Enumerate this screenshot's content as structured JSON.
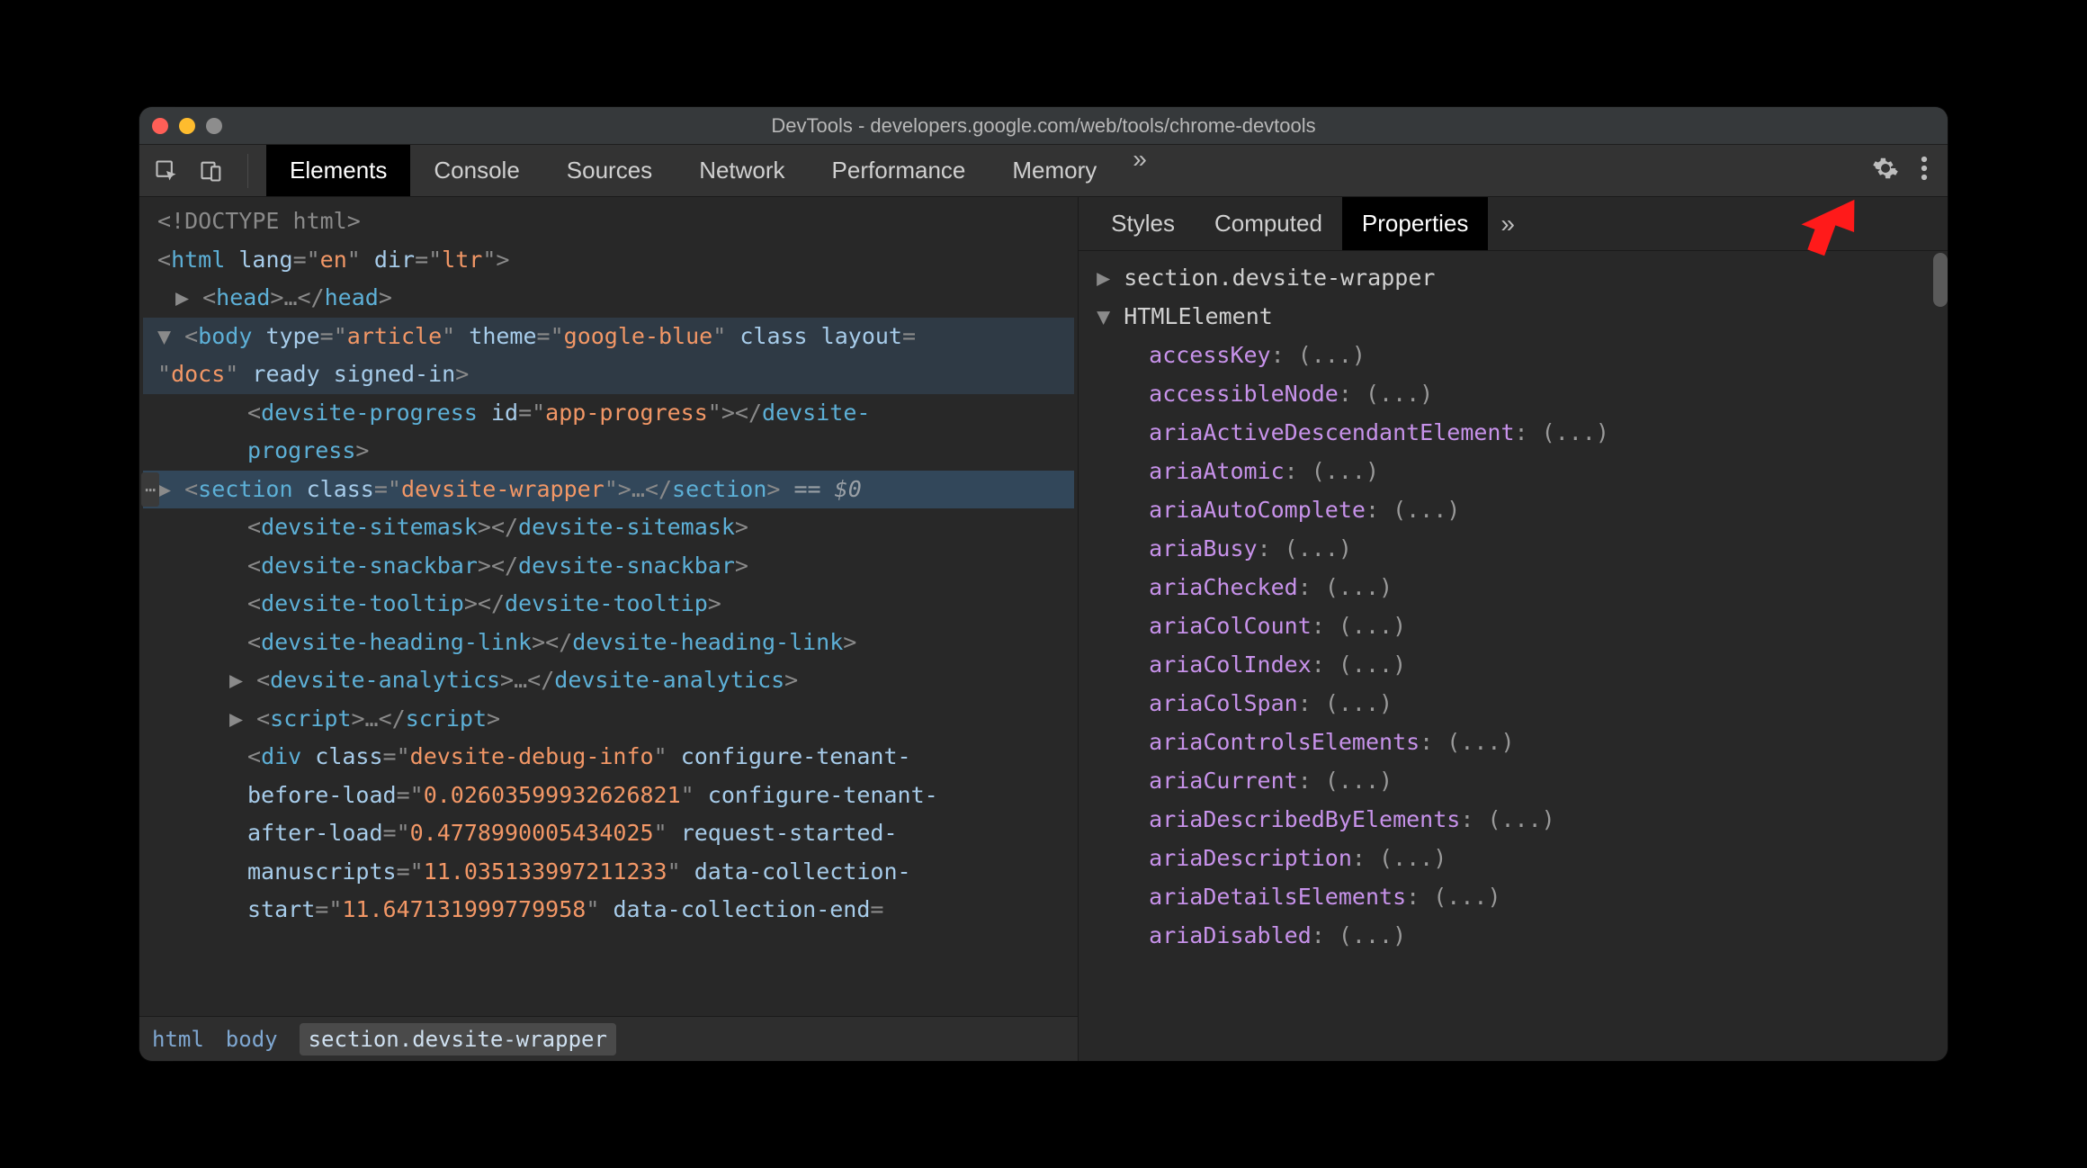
{
  "window": {
    "title": "DevTools - developers.google.com/web/tools/chrome-devtools"
  },
  "toolbar": {
    "tabs": [
      "Elements",
      "Console",
      "Sources",
      "Network",
      "Performance",
      "Memory"
    ],
    "active_tab": 0
  },
  "dom": {
    "doctype": "<!DOCTYPE html>",
    "html_open": {
      "lang": "en",
      "dir": "ltr"
    },
    "head_label": "head",
    "body_attrs": {
      "type": "article",
      "theme": "google-blue",
      "layout": "docs"
    },
    "progress": {
      "tag": "devsite-progress",
      "id": "app-progress"
    },
    "section": {
      "tag": "section",
      "class": "devsite-wrapper",
      "suffix": "== $0"
    },
    "sitemask": "devsite-sitemask",
    "snackbar": "devsite-snackbar",
    "tooltip": "devsite-tooltip",
    "headinglink": "devsite-heading-link",
    "analytics": "devsite-analytics",
    "script": "script",
    "debug": {
      "class": "devsite-debug-info",
      "cfg_before": "0.02603599932626821",
      "cfg_after": "0.4778990005434025",
      "req_started": "11.035133997211233",
      "dc_start": "11.647131999779958"
    }
  },
  "breadcrumbs": [
    "html",
    "body",
    "section.devsite-wrapper"
  ],
  "right": {
    "tabs": [
      "Styles",
      "Computed",
      "Properties"
    ],
    "active_tab": 2,
    "header": "section.devsite-wrapper",
    "proto": "HTMLElement",
    "props": [
      "accessKey",
      "accessibleNode",
      "ariaActiveDescendantElement",
      "ariaAtomic",
      "ariaAutoComplete",
      "ariaBusy",
      "ariaChecked",
      "ariaColCount",
      "ariaColIndex",
      "ariaColSpan",
      "ariaControlsElements",
      "ariaCurrent",
      "ariaDescribedByElements",
      "ariaDescription",
      "ariaDetailsElements",
      "ariaDisabled"
    ],
    "ellipsis": "(...)"
  }
}
